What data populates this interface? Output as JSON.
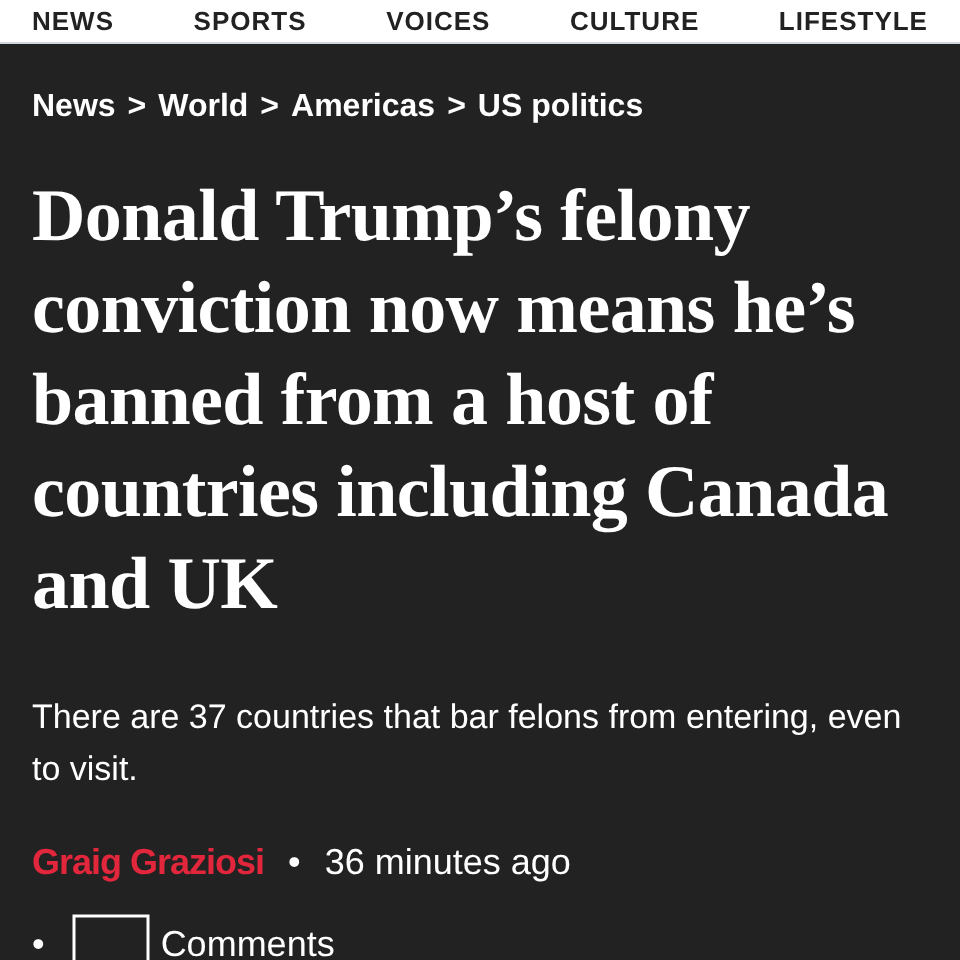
{
  "nav": [
    {
      "label": "NEWS"
    },
    {
      "label": "SPORTS"
    },
    {
      "label": "VOICES"
    },
    {
      "label": "CULTURE"
    },
    {
      "label": "LIFESTYLE"
    }
  ],
  "breadcrumb": [
    "News",
    "World",
    "Americas",
    "US politics"
  ],
  "breadcrumb_separator": ">",
  "headline": "Donald Trump’s felony conviction now means he’s banned from a host of countries including Canada and UK",
  "standfirst": "There are 37 countries that bar felons from entering, even to visit.",
  "byline": {
    "author": "Graig Graziosi",
    "separator": "•",
    "time": "36 minutes ago"
  },
  "comments": {
    "bullet": "•",
    "label": "Comments"
  }
}
